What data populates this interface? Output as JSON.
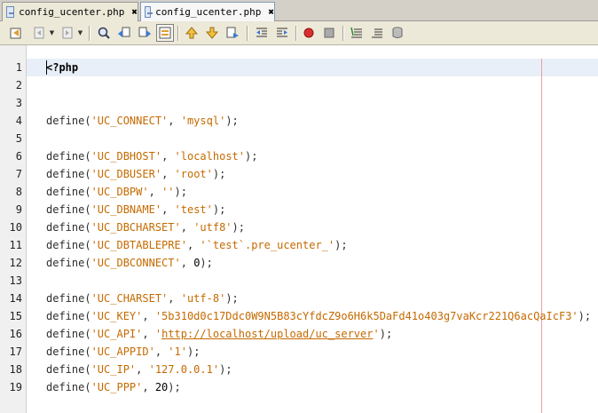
{
  "tabs": [
    {
      "label": "config_ucenter.php",
      "close": "✖",
      "active": false
    },
    {
      "label": "config_ucenter.php",
      "close": "✖",
      "active": true
    }
  ],
  "toolbar": {
    "icons": [
      "last-edit-icon",
      "back-icon",
      "forward-icon",
      "find-selection-icon",
      "find-previous-icon",
      "find-next-icon",
      "toggle-highlight-icon",
      "previous-bookmark-icon",
      "next-bookmark-icon",
      "toggle-bookmark-icon",
      "shift-left-icon",
      "shift-right-icon",
      "start-macro-icon",
      "stop-macro-icon",
      "comment-icon",
      "uncomment-icon",
      "database-icon"
    ]
  },
  "editor": {
    "lines": [
      {
        "n": "1",
        "parts": [
          {
            "t": "<?php",
            "c": "php"
          }
        ]
      },
      {
        "n": "2",
        "parts": []
      },
      {
        "n": "3",
        "parts": []
      },
      {
        "n": "4",
        "parts": [
          {
            "t": "define(",
            "c": "kw"
          },
          {
            "t": "'UC_CONNECT'",
            "c": "str"
          },
          {
            "t": ", ",
            "c": "kw"
          },
          {
            "t": "'mysql'",
            "c": "str"
          },
          {
            "t": ");",
            "c": "kw"
          }
        ]
      },
      {
        "n": "5",
        "parts": []
      },
      {
        "n": "6",
        "parts": [
          {
            "t": "define(",
            "c": "kw"
          },
          {
            "t": "'UC_DBHOST'",
            "c": "str"
          },
          {
            "t": ", ",
            "c": "kw"
          },
          {
            "t": "'localhost'",
            "c": "str"
          },
          {
            "t": ");",
            "c": "kw"
          }
        ]
      },
      {
        "n": "7",
        "parts": [
          {
            "t": "define(",
            "c": "kw"
          },
          {
            "t": "'UC_DBUSER'",
            "c": "str"
          },
          {
            "t": ", ",
            "c": "kw"
          },
          {
            "t": "'root'",
            "c": "str"
          },
          {
            "t": ");",
            "c": "kw"
          }
        ]
      },
      {
        "n": "8",
        "parts": [
          {
            "t": "define(",
            "c": "kw"
          },
          {
            "t": "'UC_DBPW'",
            "c": "str"
          },
          {
            "t": ", ",
            "c": "kw"
          },
          {
            "t": "''",
            "c": "str"
          },
          {
            "t": ");",
            "c": "kw"
          }
        ]
      },
      {
        "n": "9",
        "parts": [
          {
            "t": "define(",
            "c": "kw"
          },
          {
            "t": "'UC_DBNAME'",
            "c": "str"
          },
          {
            "t": ", ",
            "c": "kw"
          },
          {
            "t": "'test'",
            "c": "str"
          },
          {
            "t": ");",
            "c": "kw"
          }
        ]
      },
      {
        "n": "10",
        "parts": [
          {
            "t": "define(",
            "c": "kw"
          },
          {
            "t": "'UC_DBCHARSET'",
            "c": "str"
          },
          {
            "t": ", ",
            "c": "kw"
          },
          {
            "t": "'utf8'",
            "c": "str"
          },
          {
            "t": ");",
            "c": "kw"
          }
        ]
      },
      {
        "n": "11",
        "parts": [
          {
            "t": "define(",
            "c": "kw"
          },
          {
            "t": "'UC_DBTABLEPRE'",
            "c": "str"
          },
          {
            "t": ", ",
            "c": "kw"
          },
          {
            "t": "'`test`.pre_ucenter_'",
            "c": "str"
          },
          {
            "t": ");",
            "c": "kw"
          }
        ]
      },
      {
        "n": "12",
        "parts": [
          {
            "t": "define(",
            "c": "kw"
          },
          {
            "t": "'UC_DBCONNECT'",
            "c": "str"
          },
          {
            "t": ", ",
            "c": "kw"
          },
          {
            "t": "0",
            "c": "num"
          },
          {
            "t": ");",
            "c": "kw"
          }
        ]
      },
      {
        "n": "13",
        "parts": []
      },
      {
        "n": "14",
        "parts": [
          {
            "t": "define(",
            "c": "kw"
          },
          {
            "t": "'UC_CHARSET'",
            "c": "str"
          },
          {
            "t": ", ",
            "c": "kw"
          },
          {
            "t": "'utf-8'",
            "c": "str"
          },
          {
            "t": ");",
            "c": "kw"
          }
        ]
      },
      {
        "n": "15",
        "parts": [
          {
            "t": "define(",
            "c": "kw"
          },
          {
            "t": "'UC_KEY'",
            "c": "str"
          },
          {
            "t": ", ",
            "c": "kw"
          },
          {
            "t": "'5b310d0c17Ddc0W9N5B83cYfdcZ9o6H6k5DaFd41o403g7vaKcr221Q6acQaIcF3'",
            "c": "str"
          },
          {
            "t": ");",
            "c": "kw"
          }
        ]
      },
      {
        "n": "16",
        "parts": [
          {
            "t": "define(",
            "c": "kw"
          },
          {
            "t": "'UC_API'",
            "c": "str"
          },
          {
            "t": ", ",
            "c": "kw"
          },
          {
            "t": "'",
            "c": "str"
          },
          {
            "t": "http://localhost/upload/uc_server",
            "c": "url"
          },
          {
            "t": "'",
            "c": "str"
          },
          {
            "t": ");",
            "c": "kw"
          }
        ]
      },
      {
        "n": "17",
        "parts": [
          {
            "t": "define(",
            "c": "kw"
          },
          {
            "t": "'UC_APPID'",
            "c": "str"
          },
          {
            "t": ", ",
            "c": "kw"
          },
          {
            "t": "'1'",
            "c": "str"
          },
          {
            "t": ");",
            "c": "kw"
          }
        ]
      },
      {
        "n": "18",
        "parts": [
          {
            "t": "define(",
            "c": "kw"
          },
          {
            "t": "'UC_IP'",
            "c": "str"
          },
          {
            "t": ", ",
            "c": "kw"
          },
          {
            "t": "'127.0.0.1'",
            "c": "str"
          },
          {
            "t": ");",
            "c": "kw"
          }
        ]
      },
      {
        "n": "19",
        "parts": [
          {
            "t": "define(",
            "c": "kw"
          },
          {
            "t": "'UC_PPP'",
            "c": "str"
          },
          {
            "t": ", ",
            "c": "kw"
          },
          {
            "t": "20",
            "c": "num"
          },
          {
            "t": ");",
            "c": "kw"
          }
        ]
      }
    ]
  }
}
